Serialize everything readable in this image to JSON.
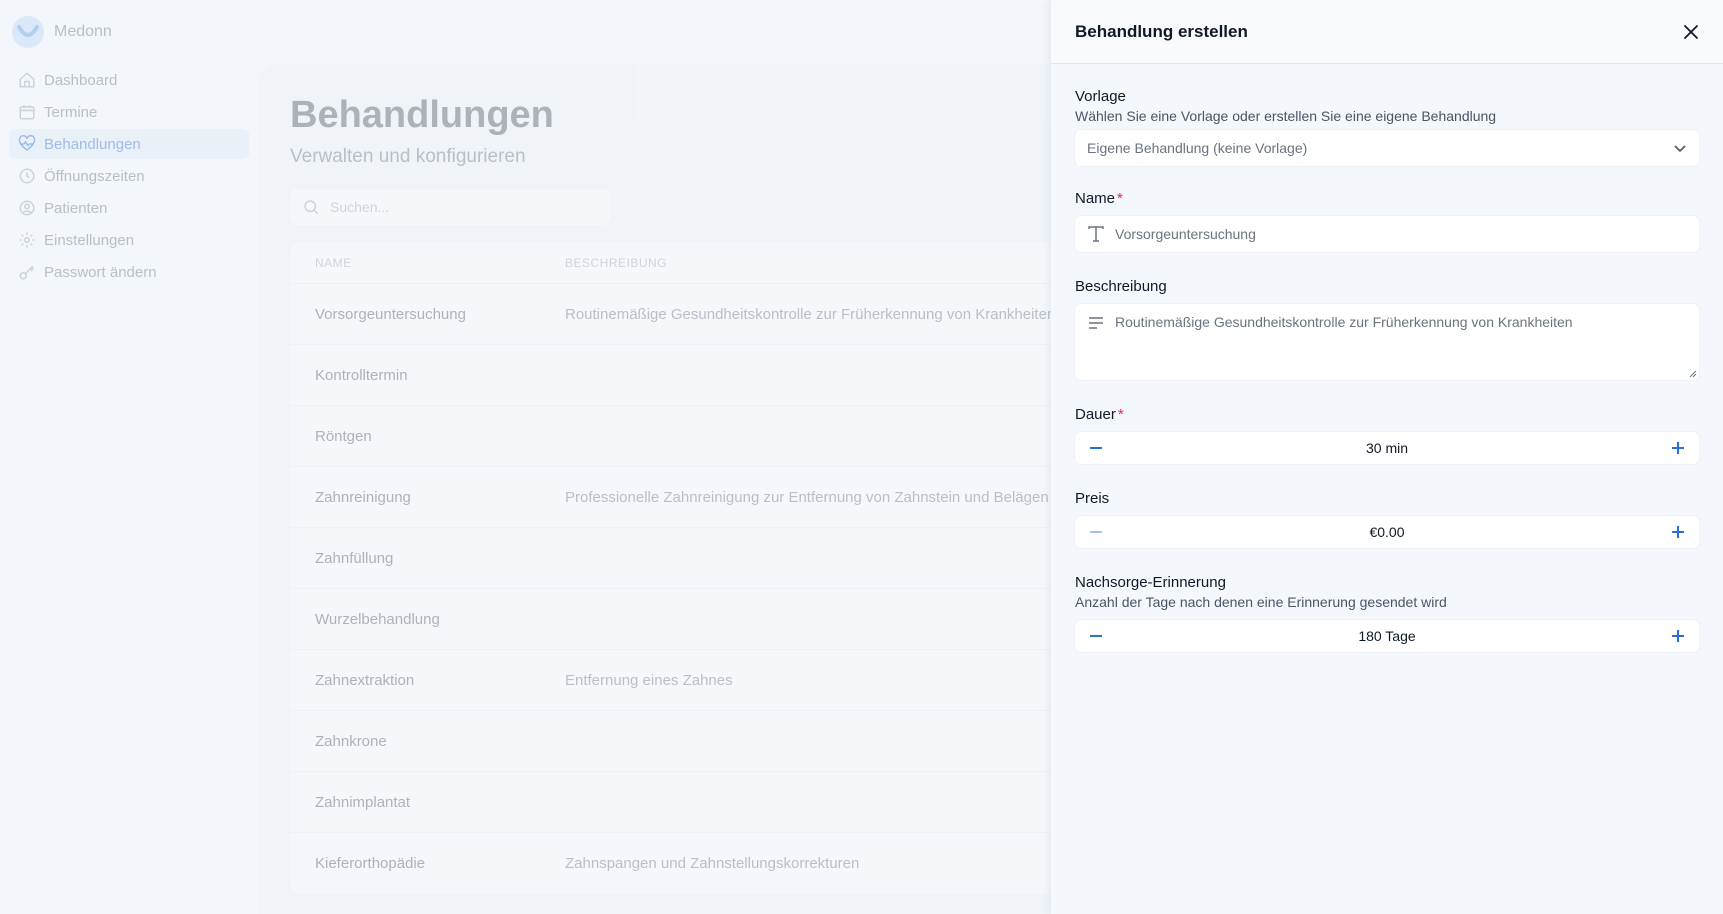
{
  "app": {
    "brand": "Medonn",
    "nav": [
      {
        "label": "Dashboard",
        "icon": "home-icon"
      },
      {
        "label": "Termine",
        "icon": "calendar-icon"
      },
      {
        "label": "Behandlungen",
        "icon": "heart-pulse-icon",
        "active": true
      },
      {
        "label": "Öffnungszeiten",
        "icon": "clock-icon"
      },
      {
        "label": "Patienten",
        "icon": "user-circle-icon"
      },
      {
        "label": "Einstellungen",
        "icon": "gear-icon"
      },
      {
        "label": "Passwort ändern",
        "icon": "key-icon"
      }
    ]
  },
  "page": {
    "title": "Behandlungen",
    "subtitle": "Verwalten und konfigurieren",
    "search_placeholder": "Suchen..."
  },
  "table": {
    "columns": [
      "NAME",
      "BESCHREIBUNG"
    ],
    "rows": [
      {
        "name": "Vorsorgeuntersuchung",
        "desc": "Routinemäßige Gesundheitskontrolle zur Früherkennung von Krankheiten"
      },
      {
        "name": "Kontrolltermin",
        "desc": ""
      },
      {
        "name": "Röntgen",
        "desc": ""
      },
      {
        "name": "Zahnreinigung",
        "desc": "Professionelle Zahnreinigung zur Entfernung von Zahnstein und Belägen"
      },
      {
        "name": "Zahnfüllung",
        "desc": ""
      },
      {
        "name": "Wurzelbehandlung",
        "desc": ""
      },
      {
        "name": "Zahnextraktion",
        "desc": "Entfernung eines Zahnes"
      },
      {
        "name": "Zahnkrone",
        "desc": ""
      },
      {
        "name": "Zahnimplantat",
        "desc": ""
      },
      {
        "name": "Kieferorthopädie",
        "desc": "Zahnspangen und Zahnstellungskorrekturen"
      }
    ]
  },
  "drawer": {
    "title": "Behandlung erstellen",
    "template": {
      "label": "Vorlage",
      "help": "Wählen Sie eine Vorlage oder erstellen Sie eine eigene Behandlung",
      "value": "Eigene Behandlung (keine Vorlage)"
    },
    "name": {
      "label": "Name",
      "required": "*",
      "placeholder": "Vorsorgeuntersuchung"
    },
    "description": {
      "label": "Beschreibung",
      "placeholder": "Routinemäßige Gesundheitskontrolle zur Früherkennung von Krankheiten"
    },
    "duration": {
      "label": "Dauer",
      "required": "*",
      "value": "30 min"
    },
    "price": {
      "label": "Preis",
      "value": "€0.00"
    },
    "followup": {
      "label": "Nachsorge-Erinnerung",
      "help": "Anzahl der Tage nach denen eine Erinnerung gesendet wird",
      "value": "180 Tage"
    }
  },
  "colors": {
    "accent": "#2b6fd6",
    "required": "#e0245e",
    "disabled": "#a9c4ec"
  }
}
